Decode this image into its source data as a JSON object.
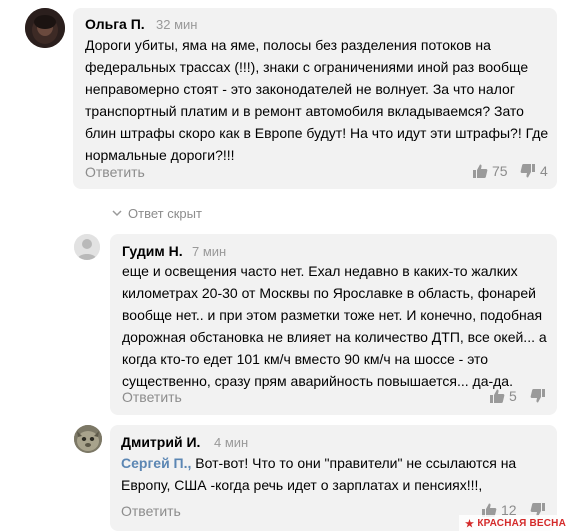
{
  "comments": [
    {
      "author": "Ольга П.",
      "time": "32 мин",
      "lines": [
        "Дороги убиты, яма на яме, полосы без разделения потоков на",
        "федеральных трассах (!!!), знаки с ограничениями иной раз вообще",
        "неправомерно стоят - это законодателей не волнует. За что налог",
        "транспортный платим и в ремонт автомобиля вкладываемся?  Зато",
        "блин штрафы скоро как в Европе  будут! На что идут эти штрафы?! Где",
        "нормальные дороги?!!!"
      ],
      "reply_label": "Ответить",
      "likes": "75",
      "dislikes": "4"
    },
    {
      "author": "Гудим Н.",
      "time": "7 мин",
      "lines": [
        "еще и освещения часто нет. Ехал недавно в каких-то жалких",
        "километрах 20-30 от Москвы по Ярославке в область, фонарей",
        "вообще нет.. и при этом разметки тоже нет. И конечно, подобная",
        "дорожная обстановка не влияет на количество ДТП, все окей... а",
        "когда кто-то едет 101 км/ч вместо 90 км/ч на шоссе  - это",
        "существенно, сразу прям аварийность повышается... да-да."
      ],
      "reply_label": "Ответить",
      "likes": "5"
    },
    {
      "author": "Дмитрий И.",
      "time": "4 мин",
      "mention": "Сергей П.,",
      "line1_rest": " Вот-вот! Что то они \"правители\" не ссылаются на",
      "line2": "Европу,  США -когда речь идет о зарплатах и пенсиях!!!,",
      "reply_label": "Ответить",
      "likes": "12"
    }
  ],
  "hidden_reply_label": "Ответ скрыт",
  "watermark": "КРАСНАЯ ВЕСНА",
  "colors": {
    "bubble": "#f2f2f2",
    "muted": "#8c8c8c",
    "mention": "#5b86b3",
    "watermark": "#d42a2a"
  }
}
